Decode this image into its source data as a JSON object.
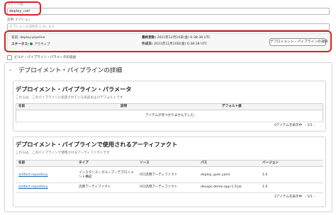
{
  "stage": {
    "name_label": "ステージ名",
    "name_value": "deploy_call",
    "description_label": "説明",
    "description_optional": "オプション",
    "description_placeholder": "オプションの説明を入力します"
  },
  "pipeline_info": {
    "name_label": "名前:",
    "name_value": "deploy-pipeline",
    "status_label": "ステータス:",
    "status_value": "アクティブ",
    "updated_label": "最終更新:",
    "updated_value": "2021年12月10日(金) 6:38:38 UTC",
    "created_label": "作成日:",
    "created_value": "2021年12月10日(金) 6:38:38 UTC",
    "select_button": "デプロイメント・パイプラインの選択",
    "status_color": "#2e8b3a"
  },
  "build_params_checkbox": "ビルド・パイプライン・パラメータの追加",
  "details": {
    "title": "デプロイメント・パイプラインの詳細",
    "params": {
      "title": "デプロイメント・パイプライン・パラメータ",
      "description": "これらは、このパイプラインに指定されている名前およびデフォルトです",
      "columns": [
        "名前",
        "説明",
        "デフォルト値"
      ],
      "empty_message": "アイテムが見つかりませんでした。",
      "count": "0アイテムを表示中",
      "page": "1/1"
    },
    "artifacts": {
      "title": "デプロイメント・パイプラインで使用されるアーティファクト",
      "description": "これらは、このパイプラインで使用されるアーティファクトです",
      "columns": [
        "名前",
        "タイプ",
        "ソース",
        "パス",
        "バージョン"
      ],
      "rows": [
        {
          "name": "artifact-repository",
          "type": "インスタンス・グループ・デプロイメント構成",
          "source": "OCI汎用アーティファクト",
          "path": "deploy_spec.yaml",
          "version": "1.0"
        },
        {
          "name": "artifact-repository",
          "type": "汎用アーティファクト",
          "source": "OCI汎用アーティファクト",
          "path": "devops-demo-app-1.0.jar",
          "version": "1.0"
        }
      ],
      "count": "2アイテムを表示中",
      "page": "1/1"
    }
  },
  "colors": {
    "highlight": "#d9201f",
    "link": "#1a5fb4"
  }
}
